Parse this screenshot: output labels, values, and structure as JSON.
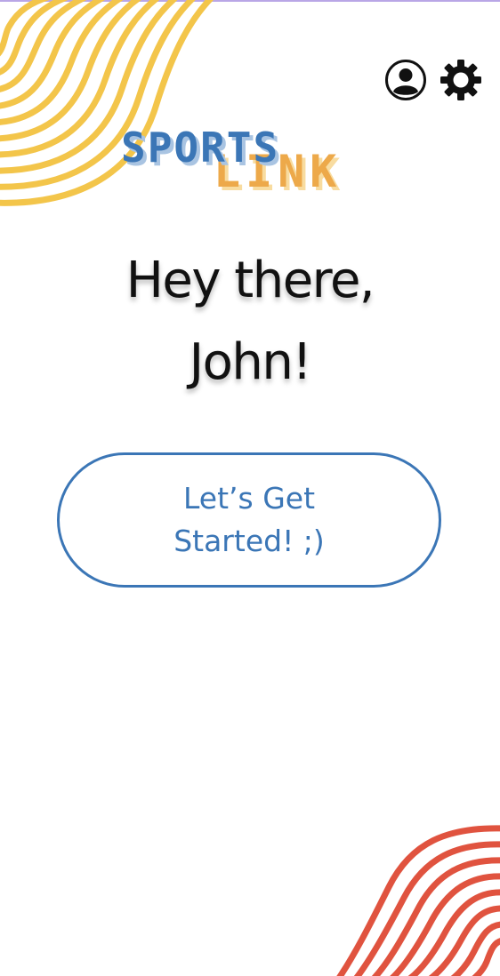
{
  "app": {
    "logo_word1": "SPORTS",
    "logo_word2": "LINK"
  },
  "header": {
    "profile_icon": "user-circle-icon",
    "settings_icon": "gear-icon"
  },
  "greeting": {
    "line1": "Hey there,",
    "line2": "John!"
  },
  "cta": {
    "line1": "Let’s Get",
    "line2": "Started! ;)"
  },
  "colors": {
    "accent_blue": "#3b76b6",
    "logo_red": "#d9473a",
    "logo_yellow": "#f2c14e",
    "deco_yellow": "#f3c54a",
    "deco_red": "#e0533f",
    "text_dark": "#111111"
  }
}
